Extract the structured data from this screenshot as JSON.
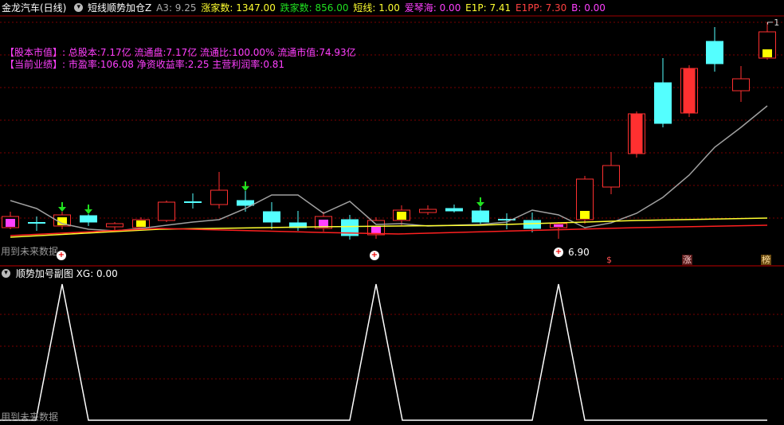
{
  "header": {
    "stock_name": "金龙汽车(日线)",
    "indicator_name": "短线顺势加仓Z",
    "a3": "A3: 9.25",
    "up_count": "涨家数: 1347.00",
    "down_count": "跌家数: 856.00",
    "short_line": "短线: 1.00",
    "aiqinhai": "爱琴海: 0.00",
    "e1p": "E1P: 7.41",
    "e1pp": "E1PP: 7.30",
    "b": "B: 0.00"
  },
  "info": {
    "capital_label": "【股本市值】:",
    "capital_text": "总股本:7.17亿 流通盘:7.17亿 流通比:100.00% 流通市值:74.93亿",
    "perf_label": "【当前业绩】:",
    "perf_text": "市盈率:106.08 净资收益率:2.25 主营利润率:0.81"
  },
  "top_right_label": "1",
  "future_data_note_top": "用到未来数据",
  "price_label": "6.90",
  "tags": {
    "s": "$",
    "zhang": "涨",
    "bang": "榜"
  },
  "sub_panel": {
    "title": "顺势加号副图",
    "xg": "XG: 0.00",
    "future_data_note": "用到未来数据"
  },
  "colors": {
    "up": "#ff3030",
    "down": "#54ffff",
    "yellow": "#ffff00",
    "magenta": "#ff40ff",
    "gray_line": "#a0a0a0",
    "red_line": "#ff2020",
    "yellow_line": "#ffff30",
    "green_arrow": "#20e020",
    "grid": "#7a0000"
  },
  "chart_data": {
    "type": "candlestick",
    "candles": [
      {
        "kind": "up",
        "fill": "magenta"
      },
      {
        "kind": "cross"
      },
      {
        "kind": "up",
        "fill": "yellow",
        "arrow": true
      },
      {
        "kind": "down",
        "arrow": true
      },
      {
        "kind": "up"
      },
      {
        "kind": "up",
        "fill": "yellow"
      },
      {
        "kind": "up"
      },
      {
        "kind": "cross"
      },
      {
        "kind": "up"
      },
      {
        "kind": "down",
        "arrow": true
      },
      {
        "kind": "down"
      },
      {
        "kind": "down"
      },
      {
        "kind": "up",
        "fill": "magenta"
      },
      {
        "kind": "down"
      },
      {
        "kind": "up",
        "fill": "magenta"
      },
      {
        "kind": "up",
        "fill": "yellow"
      },
      {
        "kind": "up"
      },
      {
        "kind": "down"
      },
      {
        "kind": "down",
        "arrow": true
      },
      {
        "kind": "cross"
      },
      {
        "kind": "down"
      },
      {
        "kind": "up",
        "fill": "magenta"
      },
      {
        "kind": "up",
        "fill": "yellow"
      },
      {
        "kind": "up"
      },
      {
        "kind": "up",
        "fill": "red"
      },
      {
        "kind": "down"
      },
      {
        "kind": "up",
        "fill": "red"
      },
      {
        "kind": "down"
      },
      {
        "kind": "up"
      },
      {
        "kind": "up",
        "fill": "yellow"
      }
    ],
    "sub_series": {
      "name": "顺势加号",
      "values": [
        0,
        0,
        1,
        0,
        0,
        0,
        0,
        0,
        0,
        0,
        0,
        0,
        0,
        0,
        1,
        0,
        0,
        0,
        0,
        0,
        0,
        1,
        0,
        0,
        0,
        0,
        0,
        0,
        0,
        0
      ]
    }
  }
}
